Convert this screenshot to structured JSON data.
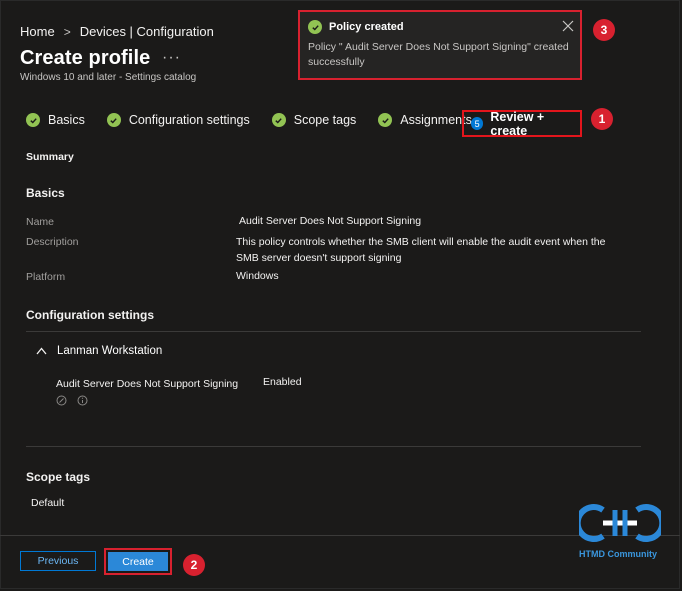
{
  "breadcrumb": {
    "home": "Home",
    "sep": ">",
    "current": "Devices | Configuration"
  },
  "page": {
    "title": "Create profile",
    "more": "···",
    "subtitle": "Windows 10 and later - Settings catalog"
  },
  "tabs": {
    "items": [
      {
        "label": "Basics"
      },
      {
        "label": "Configuration settings"
      },
      {
        "label": "Scope tags"
      },
      {
        "label": "Assignments"
      }
    ],
    "active": {
      "number": "5",
      "label": "Review + create"
    }
  },
  "summary": {
    "heading": "Summary",
    "basics_heading": "Basics",
    "rows": [
      {
        "label": "Name",
        "value": "Audit Server Does Not Support Signing"
      },
      {
        "label": "Description",
        "value": "This policy controls whether the SMB client will enable the audit event when the SMB server doesn't support signing"
      },
      {
        "label": "Platform",
        "value": "Windows"
      }
    ],
    "config_heading": "Configuration settings",
    "group": {
      "label": "Lanman Workstation"
    },
    "setting": {
      "name": "Audit Server Does Not Support Signing",
      "value": "Enabled"
    },
    "scope_heading": "Scope tags",
    "scope_value": "Default"
  },
  "toast": {
    "title": "Policy created",
    "body": "Policy \" Audit Server Does Not Support Signing\" created successfully"
  },
  "footer": {
    "previous": "Previous",
    "create": "Create"
  },
  "annotations": {
    "one": "1",
    "two": "2",
    "three": "3"
  },
  "logo": {
    "text": "HTMD Community"
  },
  "colors": {
    "accent": "#0078d4",
    "success": "#92c353",
    "highlight": "#d8212f"
  }
}
